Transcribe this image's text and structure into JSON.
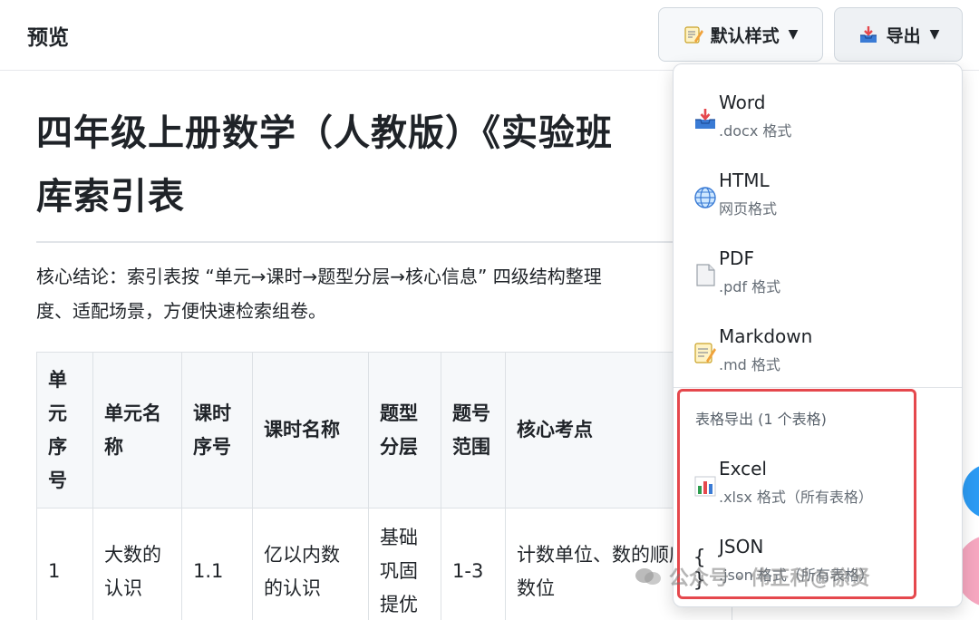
{
  "header": {
    "title": "预览",
    "style_button": "默认样式",
    "export_button": "导出"
  },
  "document": {
    "title": "四年级上册数学（人教版）《实验班",
    "title_line2": "库索引表",
    "summary_line1": "核心结论：索引表按 “单元→课时→题型分层→核心信息” 四级结构整理",
    "summary_line2": "度、适配场景，方便快速检索组卷。",
    "table": {
      "headers": [
        "单元序号",
        "单元名称",
        "课时序号",
        "课时名称",
        "题型分层",
        "题号范围",
        "核心考点"
      ],
      "rows": [
        [
          "1",
          "大数的认识",
          "1.1",
          "亿以内数的认识",
          "基础巩固提优",
          "1-3",
          "计数单位、数的顺序、数位"
        ]
      ]
    }
  },
  "export_menu": {
    "items": [
      {
        "name": "Word",
        "desc": ".docx 格式",
        "icon": "inbox-tray-icon"
      },
      {
        "name": "HTML",
        "desc": "网页格式",
        "icon": "globe-icon"
      },
      {
        "name": "PDF",
        "desc": ".pdf 格式",
        "icon": "document-icon"
      },
      {
        "name": "Markdown",
        "desc": ".md 格式",
        "icon": "memo-icon"
      }
    ],
    "section_title": "表格导出 (1 个表格)",
    "table_items": [
      {
        "name": "Excel",
        "desc": ".xlsx 格式（所有表格）",
        "icon": "bar-chart-icon"
      },
      {
        "name": "JSON",
        "desc": ".json 格式（所有表格）",
        "icon": "braces-icon"
      }
    ]
  },
  "watermark": "公众号 · 伟正科@徐贤",
  "colors": {
    "highlight_border": "#e5484d",
    "accent_blue": "#2b9bf4"
  }
}
